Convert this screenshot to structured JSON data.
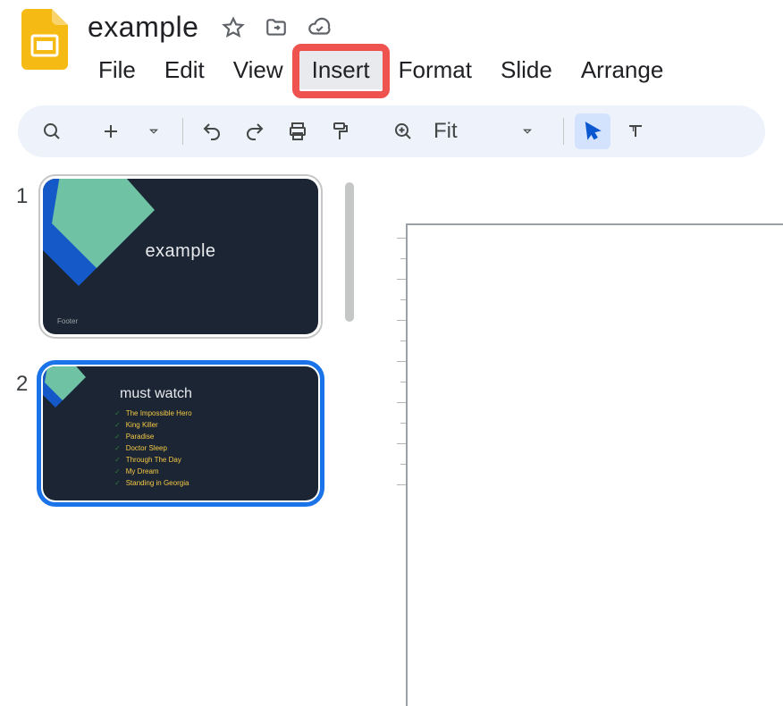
{
  "doc": {
    "title": "example"
  },
  "menu": {
    "file": "File",
    "edit": "Edit",
    "view": "View",
    "insert": "Insert",
    "format": "Format",
    "slide": "Slide",
    "arrange": "Arrange"
  },
  "toolbar": {
    "zoom_label": "Fit"
  },
  "thumbs": {
    "n1": "1",
    "n2": "2",
    "slide1": {
      "title": "example",
      "footer": "Footer"
    },
    "slide2": {
      "title": "must watch",
      "items": {
        "i0": "The Impossible Hero",
        "i1": "King Killer",
        "i2": "Paradise",
        "i3": "Doctor Sleep",
        "i4": "Through The Day",
        "i5": "My Dream",
        "i6": "Standing in Georgia"
      }
    }
  }
}
